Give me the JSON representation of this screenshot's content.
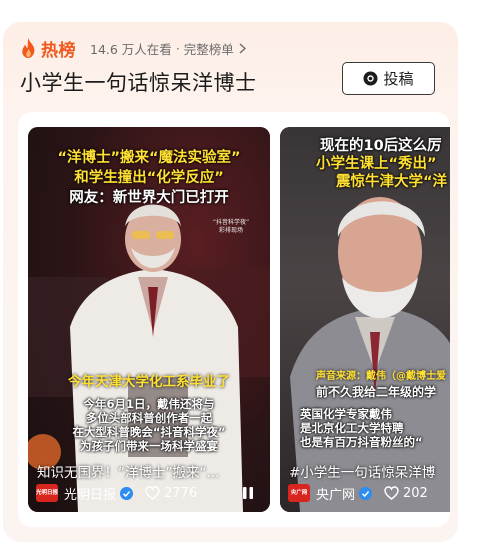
{
  "header": {
    "hot_label": "热榜",
    "viewers": "14.6 万人在看",
    "separator": "·",
    "full_list": "完整榜单",
    "topic_title": "小学生一句话惊呆洋博士",
    "submit_label": "投稿"
  },
  "colors": {
    "accent": "#f0581e",
    "panel_bg": "#fdeee6",
    "caption_yellow": "#ffe033"
  },
  "cards": [
    {
      "caption_line1": "“洋博士”搬来“魔法实验室”",
      "caption_line2": "和学生撞出“化学反应”",
      "caption_line3": "网友：新世界大门已打开",
      "watermark": "“抖音科学夜”\n彩排现场",
      "mid_caption": "今年天津大学化工系毕业了",
      "sub_caption": "今年6月1日，戴伟还将与\n多位头部科普创作者一起\n在大型科普晚会“抖音科学夜”\n为孩子们带来一场科学盛宴",
      "title": "知识无国界！“洋博士”搬来“...",
      "source_logo": "光明日报",
      "source": "光明日报",
      "likes": "2776"
    },
    {
      "caption_line1": "现在的10后这么厉",
      "caption_line2": "小学生课上“秀出”",
      "caption_line3": "震惊牛津大学“洋",
      "mid_caption": "声音来源：戴伟（@戴博士爱",
      "sub_caption1": "前不久我给二年级的学",
      "sub_caption2": "英国化学专家戴伟\n是北京化工大学特聘\n也是有百万抖音粉丝的“",
      "title": "#小学生一句话惊呆洋博",
      "source_logo": "央广网",
      "source": "央广网",
      "likes": "202"
    }
  ]
}
